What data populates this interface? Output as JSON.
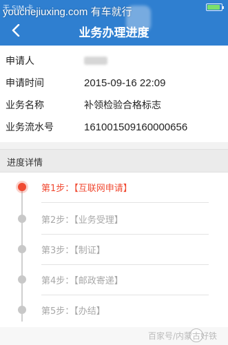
{
  "status_bar": {
    "carrier": "无 SIM 卡",
    "watermark": "youchejiuxing.com 有车就行"
  },
  "nav": {
    "title": "业务办理进度",
    "back_icon": "chevron-left-icon"
  },
  "info": {
    "rows": [
      {
        "label": "申请人",
        "value": "罗建刚"
      },
      {
        "label": "申请时间",
        "value": "2015-09-16 22:09"
      },
      {
        "label": "业务名称",
        "value": "补领检验合格标志"
      },
      {
        "label": "业务流水号",
        "value": "161001509160000656"
      }
    ]
  },
  "progress": {
    "header": "进度详情",
    "steps": [
      {
        "label": "第1步：【互联网申请】",
        "active": true
      },
      {
        "label": "第2步：【业务受理】",
        "active": false
      },
      {
        "label": "第3步：【制证】",
        "active": false
      },
      {
        "label": "第4步：【邮政寄递】",
        "active": false
      },
      {
        "label": "第5步：【办结】",
        "active": false
      }
    ]
  },
  "colors": {
    "brand_blue": "#2f7fd0",
    "active_red": "#f04a32",
    "inactive_gray": "#a8a8a8"
  },
  "watermark_bottom": "百家号/内蒙古好铁"
}
